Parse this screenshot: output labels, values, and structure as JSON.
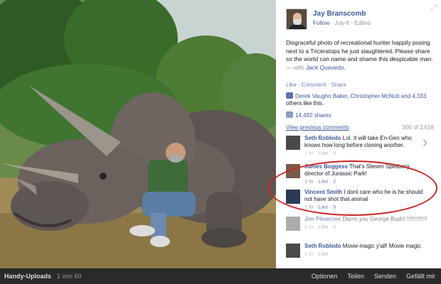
{
  "bottom_bar": {
    "album": "Handy-Uploads",
    "counter": "1 von 60",
    "actions": [
      "Optionen",
      "Teilen",
      "Senden",
      "Gefällt mir"
    ]
  },
  "post": {
    "author": "Jay Branscomb",
    "follow": "Follow",
    "date": "July 6",
    "edited": "Edited",
    "text": "Disgraceful photo of recreational hunter happily posing next to a Triceratops he just slaughtered. Please share so the world can name and shame this despicable man.",
    "with_prefix": "— with",
    "tagged": "Jack Quevedo",
    "actions": {
      "like": "Like",
      "comment": "Comment",
      "share": "Share"
    },
    "likes_text": "Derek Vaughn Baker, Christopher McNutt and 4,333",
    "likes_tail": "others like this.",
    "shares": "14,492 shares",
    "view_previous": "View previous comments",
    "comment_count": "306 of 2,618"
  },
  "comments": [
    {
      "name": "Seth Robledo",
      "text": "Lol. It will take En-Gen who knows how long before cloning another.",
      "time": "1 hr",
      "like": "Like",
      "likes": "4"
    },
    {
      "name": "James Boggess",
      "text": "That's Steven Spielberg, director of Jurassic Park!",
      "time": "1 hr",
      "like": "Like",
      "likes": "2"
    },
    {
      "name": "Vincent Smith",
      "text": "I dont care who he is he should not have shot that animal",
      "time": "1 hr",
      "like": "Like",
      "likes": "9"
    },
    {
      "name": "Jim Plowcree",
      "text": "Damn you George Bush! !!!!!!!!!!!!!",
      "time": "1 hr",
      "like": "Like",
      "likes": "5"
    },
    {
      "name": "Seth Robledo",
      "text": "Movie magic y'all! Movie magic.",
      "time": "1 hr",
      "like": "Like",
      "likes": ""
    }
  ],
  "colors": {
    "link": "#3b5998",
    "highlight": "#cc2222"
  }
}
